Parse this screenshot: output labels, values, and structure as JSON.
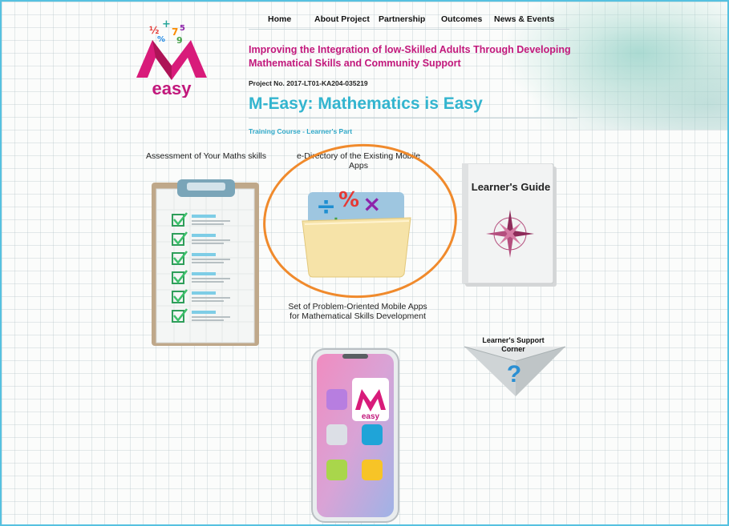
{
  "nav": {
    "items": [
      "Home",
      "About Project",
      "Partnership",
      "Outcomes",
      "News & Events"
    ]
  },
  "logo": {
    "text": "easy",
    "letter": "M"
  },
  "header": {
    "headline": "Improving the Integration of low-Skilled Adults Through Developing Mathematical Skills and Community Support",
    "project_no": "Project No. 2017-LT01-KA204-035219",
    "title": "M-Easy: Mathematics is Easy",
    "training": "Training Course - Learner's Part"
  },
  "sections": {
    "assessment": "Assessment of Your Maths skills",
    "directory": "e-Directory of the Existing Mobile Apps",
    "apps_set": "Set of Problem-Oriented Mobile Apps for Mathematical Skills Development",
    "guide": "Learner's Guide",
    "support": "Learner's Support Corner",
    "support_symbol": "?"
  },
  "colors": {
    "brand_pink": "#c2187c",
    "title_teal": "#33b5cf",
    "highlight_orange": "#f08a2c",
    "frame_blue": "#56c1e0"
  }
}
